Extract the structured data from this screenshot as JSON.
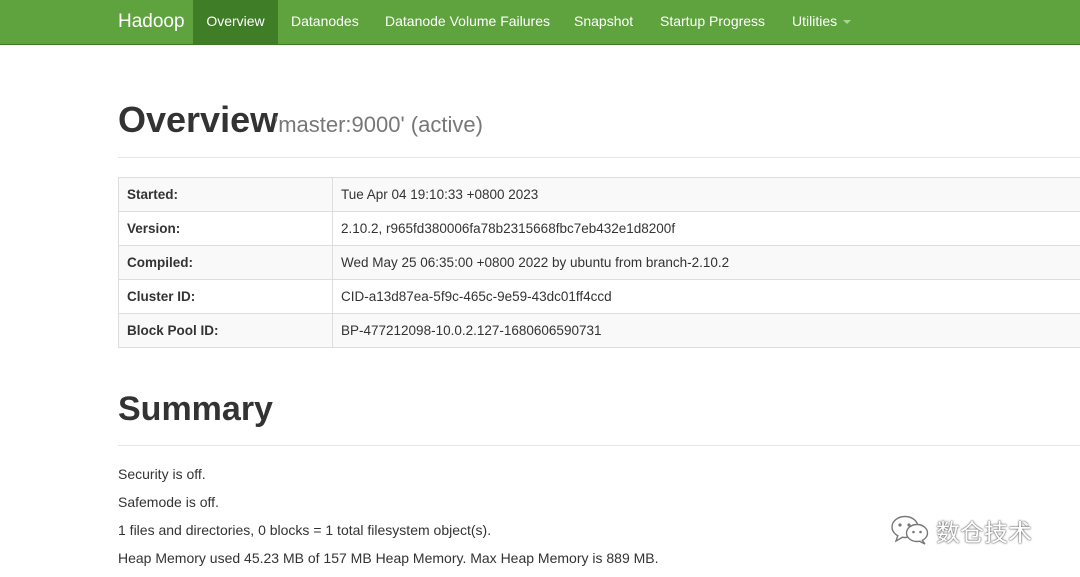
{
  "navbar": {
    "brand": "Hadoop",
    "items": [
      {
        "label": "Overview",
        "active": true
      },
      {
        "label": "Datanodes"
      },
      {
        "label": "Datanode Volume Failures"
      },
      {
        "label": "Snapshot"
      },
      {
        "label": "Startup Progress"
      },
      {
        "label": "Utilities",
        "dropdown": true
      }
    ]
  },
  "overview": {
    "title": "Overview",
    "subtitle": "'master:9000' (active)",
    "rows": [
      {
        "key": "Started:",
        "value": "Tue Apr 04 19:10:33 +0800 2023"
      },
      {
        "key": "Version:",
        "value": "2.10.2, r965fd380006fa78b2315668fbc7eb432e1d8200f"
      },
      {
        "key": "Compiled:",
        "value": "Wed May 25 06:35:00 +0800 2022 by ubuntu from branch-2.10.2"
      },
      {
        "key": "Cluster ID:",
        "value": "CID-a13d87ea-5f9c-465c-9e59-43dc01ff4ccd"
      },
      {
        "key": "Block Pool ID:",
        "value": "BP-477212098-10.0.2.127-1680606590731"
      }
    ]
  },
  "summary": {
    "title": "Summary",
    "lines": [
      "Security is off.",
      "Safemode is off.",
      "1 files and directories, 0 blocks = 1 total filesystem object(s).",
      "Heap Memory used 45.23 MB of 157 MB Heap Memory. Max Heap Memory is 889 MB."
    ]
  },
  "watermark": {
    "text": "数仓技术",
    "icon": "wechat-icon"
  },
  "colors": {
    "navbar": "#5fa33e",
    "navbar_active": "#3f7e27"
  }
}
